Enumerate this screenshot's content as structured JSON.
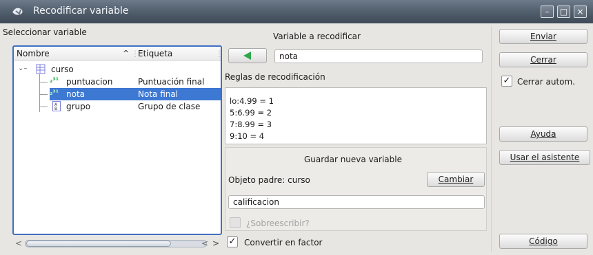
{
  "window": {
    "title": "Recodificar variable",
    "controls": {
      "minimize": "–",
      "maximize": "□",
      "close": "×"
    }
  },
  "left": {
    "section_label": "Seleccionar variable",
    "columns": {
      "name": "Nombre",
      "label": "Etiqueta",
      "sort_icon": "^"
    },
    "root": {
      "name": "curso",
      "icon": "dataframe-icon"
    },
    "items": [
      {
        "name": "puntuacion",
        "label": "Puntuación final",
        "icon": "numeric-icon"
      },
      {
        "name": "nota",
        "label": "Nota final",
        "icon": "numeric-icon",
        "selected": true
      },
      {
        "name": "grupo",
        "label": "Grupo de clase",
        "icon": "factor-icon"
      }
    ],
    "scroll": {
      "left": "<",
      "right": ">",
      "left2": "<"
    }
  },
  "middle": {
    "variable_label": "Variable a recodificar",
    "variable_value": "nota",
    "rules_label": "Reglas de recodificación",
    "rules": [
      "lo:4.99 = 1",
      "5:6.99 = 2",
      "7:8.99 = 3",
      "9:10 = 4"
    ],
    "save_label": "Guardar nueva variable",
    "parent_label": "Objeto padre: curso",
    "change_button": "Cambiar",
    "new_var_value": "calificacion",
    "overwrite_label": "¿Sobreescribir?",
    "overwrite_checked": false,
    "factor_label": "Convertir en factor",
    "factor_checked": true
  },
  "right": {
    "send": "Enviar",
    "close": "Cerrar",
    "autoclose_label": "Cerrar autom.",
    "autoclose_checked": true,
    "help": "Ayuda",
    "wizard": "Usar el asistente",
    "code": "Código"
  },
  "colors": {
    "selection": "#3d78d3",
    "accent_arrow": "#2ea84a",
    "title_bar": "#4f5c6a"
  }
}
